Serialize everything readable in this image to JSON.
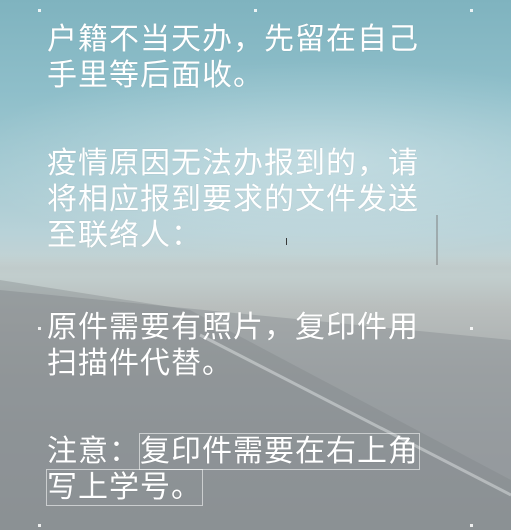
{
  "slide": {
    "paragraph1": {
      "line1": "户籍不当天办，先留在自己",
      "line2": "手里等后面收。"
    },
    "paragraph2": {
      "line1": "疫情原因无法办报到的，请",
      "line2": "将相应报到要求的文件发送",
      "line3": "至联络人："
    },
    "paragraph3": {
      "line1": "原件需要有照片，复印件用",
      "line2": "扫描件代替。"
    },
    "paragraph4": {
      "label": "注意：",
      "boxed_line1": "复印件需要在右上角",
      "boxed_line2": "写上学号。"
    }
  }
}
